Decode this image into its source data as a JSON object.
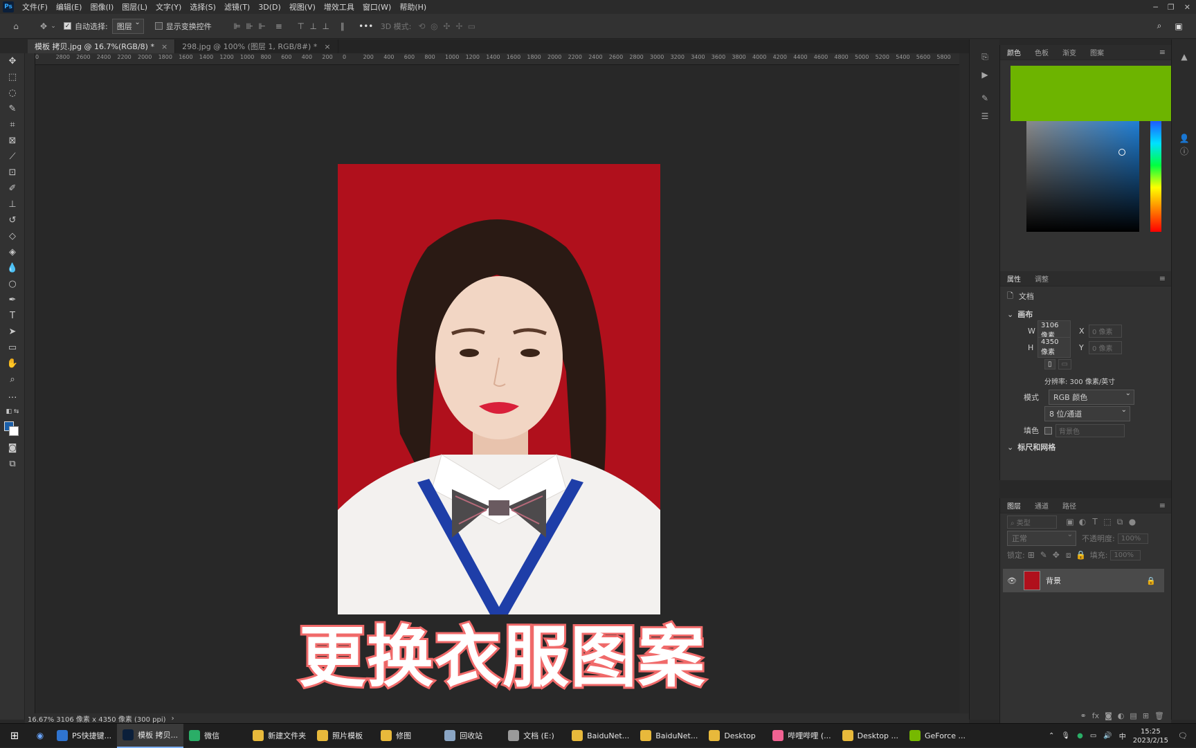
{
  "app": {
    "logo": "Ps"
  },
  "menu": [
    "文件(F)",
    "编辑(E)",
    "图像(I)",
    "图层(L)",
    "文字(Y)",
    "选择(S)",
    "滤镜(T)",
    "3D(D)",
    "视图(V)",
    "增效工具",
    "窗口(W)",
    "帮助(H)"
  ],
  "options": {
    "auto_select_label": "自动选择:",
    "auto_select_value": "图层",
    "show_transform_label": "显示变换控件",
    "mode_3d_label": "3D 模式:"
  },
  "doc_tabs": [
    {
      "label": "模板 拷贝.jpg @ 16.7%(RGB/8) *"
    },
    {
      "label": "298.jpg @ 100% (图层 1, RGB/8#) *"
    }
  ],
  "ruler_h": [
    "0",
    "2800",
    "2600",
    "2400",
    "2200",
    "2000",
    "1800",
    "1600",
    "1400",
    "1200",
    "1000",
    "800",
    "600",
    "400",
    "200",
    "0",
    "200",
    "400",
    "600",
    "800",
    "1000",
    "1200",
    "1400",
    "1600",
    "1800",
    "2000",
    "2200",
    "2400",
    "2600",
    "2800",
    "3000",
    "3200",
    "3400",
    "3600",
    "3800",
    "4000",
    "4200",
    "4400",
    "4600",
    "4800",
    "5000",
    "5200",
    "5400",
    "5600",
    "5800"
  ],
  "overlay_title": "更换衣服图案",
  "status_text": "16.67%   3106 像素 x 4350 像素 (300 ppi)",
  "color_panel": {
    "tabs": [
      "颜色",
      "色板",
      "渐变",
      "图案"
    ],
    "foreground": "#6db400"
  },
  "properties": {
    "tabs": [
      "属性",
      "调整"
    ],
    "doc_label": "文档",
    "canvas_section": "画布",
    "w_label": "W",
    "w_value": "3106 像素",
    "h_label": "H",
    "h_value": "4350 像素",
    "x_label": "X",
    "x_placeholder": "0 像素",
    "y_label": "Y",
    "y_placeholder": "0 像素",
    "resolution": "分辨率: 300 像素/英寸",
    "mode_label": "模式",
    "mode_value": "RGB 颜色",
    "depth_value": "8 位/通道",
    "fill_label": "填色",
    "fill_value": "背景色",
    "rulers_section": "标尺和网格"
  },
  "layers": {
    "tabs": [
      "图层",
      "通道",
      "路径"
    ],
    "search_placeholder": "类型",
    "blend_mode": "正常",
    "opacity_label": "不透明度:",
    "opacity_value": "100%",
    "lock_label": "锁定:",
    "fill_label": "填充:",
    "fill_value": "100%",
    "items": [
      {
        "name": "背景"
      }
    ]
  },
  "taskbar": [
    {
      "label": "PS快捷键...",
      "color": "#2f74d0"
    },
    {
      "label": "模板 拷贝...",
      "color": "#0b1f3a"
    },
    {
      "label": "微信",
      "color": "#2aae67"
    },
    {
      "label": "新建文件夹",
      "color": "#e8b93b"
    },
    {
      "label": "照片模板",
      "color": "#e8b93b"
    },
    {
      "label": "修图",
      "color": "#e8b93b"
    },
    {
      "label": "回收站",
      "color": "#8aa5c4"
    },
    {
      "label": "文档 (E:)",
      "color": "#9a9a9a"
    },
    {
      "label": "BaiduNet...",
      "color": "#e8b93b"
    },
    {
      "label": "BaiduNet...",
      "color": "#e8b93b"
    },
    {
      "label": "Desktop",
      "color": "#e8b93b"
    },
    {
      "label": "哔哩哔哩 (...",
      "color": "#f06292"
    },
    {
      "label": "Desktop ...",
      "color": "#e8b93b"
    },
    {
      "label": "GeForce ...",
      "color": "#76b900"
    }
  ],
  "clock": {
    "time": "15:25",
    "date": "2023/2/15",
    "ime": "中"
  }
}
